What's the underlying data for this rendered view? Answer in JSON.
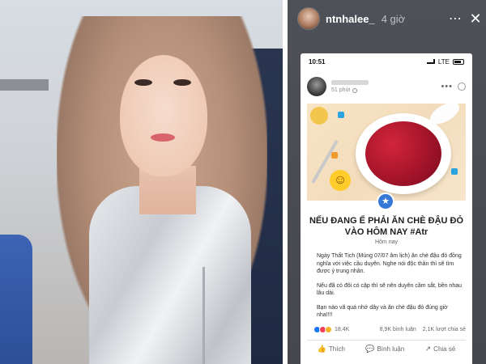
{
  "story": {
    "username": "ntnhalee_",
    "time": "4 giờ",
    "more_icon": "⋯",
    "close_icon": "✕"
  },
  "phone_status": {
    "time": "10:51",
    "network": "LTE"
  },
  "post": {
    "meta": "51 phút",
    "title": "NẾU ĐANG Ế PHẢI ĂN CHÈ ĐẬU ĐỎ VÀO HÔM NAY #Atr",
    "date": "Hôm nay",
    "paragraphs": [
      "Ngày Thất Tịch (Mùng 07/07 âm lịch) ăn chè đậu đỏ đồng nghĩa với việc cầu duyên. Nghe nói độc thân thì sẽ tìm được ý trung nhân.",
      "Nếu đã có đôi có cặp thì sẽ nên duyên cầm sắt, bền nhau lâu dài.",
      "Bạn nào vã quá nhớ dây và ăn chè đậu đỏ đúng giờ nha!!!!"
    ],
    "reactions_count": "18,4K",
    "comments": "8,9K bình luận",
    "shares": "2,1K lượt chia sẻ",
    "actions": {
      "like": "Thích",
      "comment": "Bình luận",
      "share": "Chia sẻ"
    }
  },
  "colors": {
    "story_bg": "#4f5158",
    "badge_blue": "#3678d6",
    "beans_red": "#a4142a"
  }
}
